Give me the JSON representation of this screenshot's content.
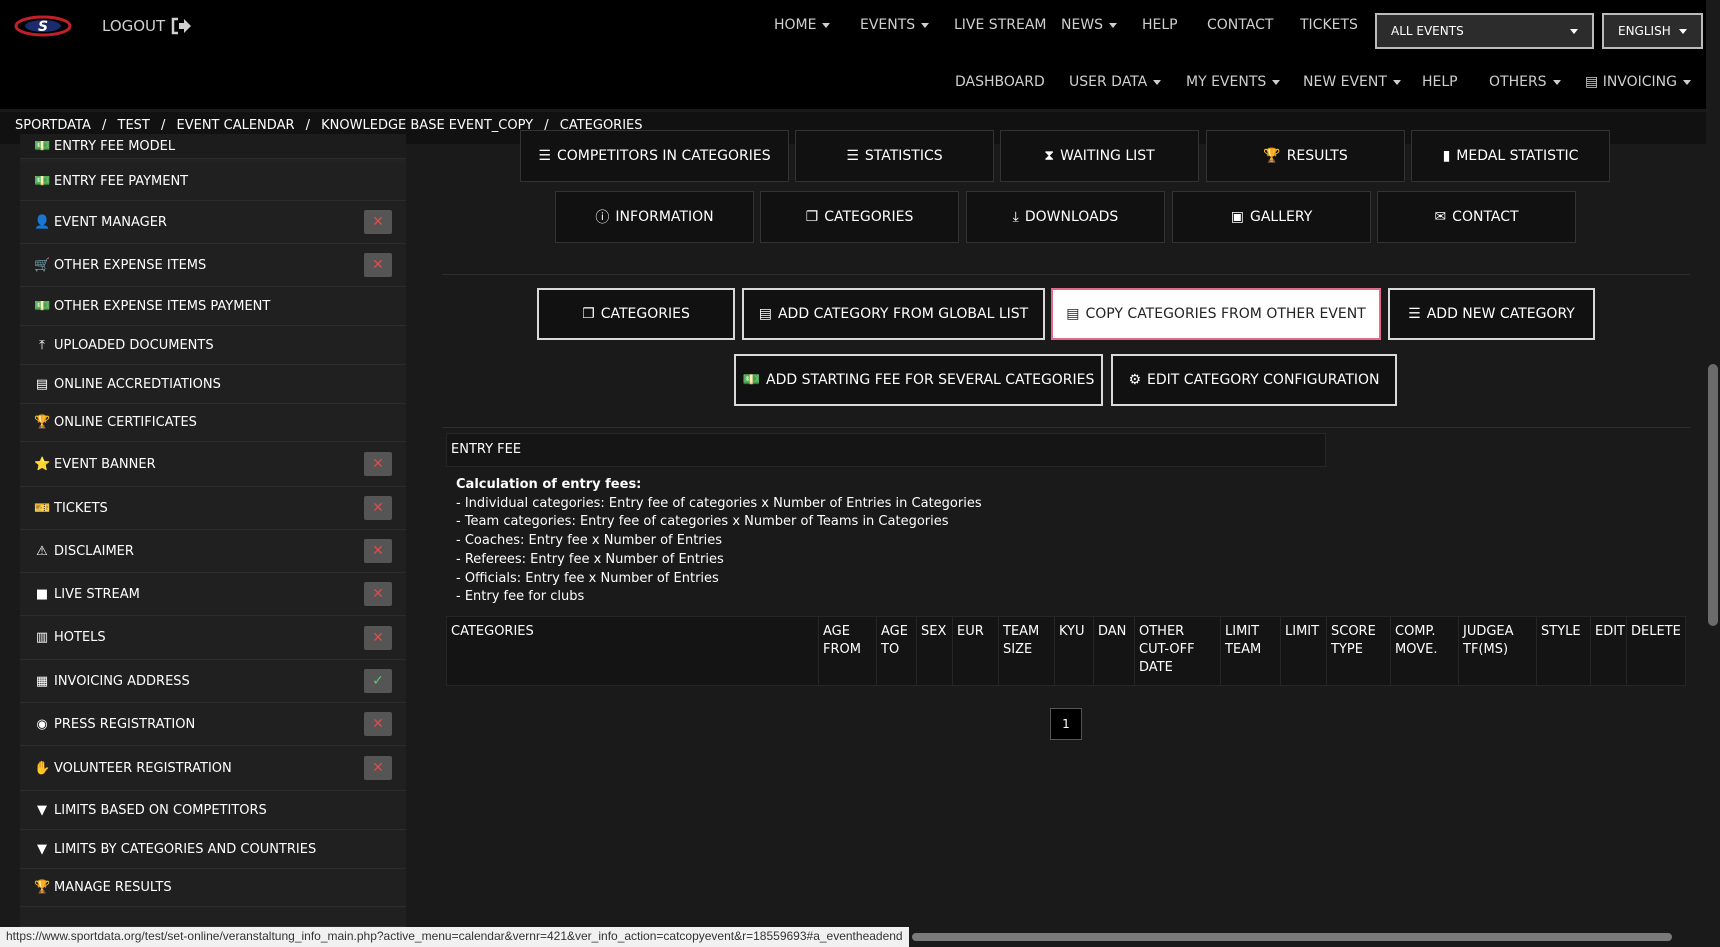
{
  "header": {
    "logout_label": "LOGOUT",
    "nav": [
      {
        "label": "HOME",
        "dropdown": true
      },
      {
        "label": "EVENTS",
        "dropdown": true
      },
      {
        "label": "LIVE STREAM",
        "dropdown": false
      },
      {
        "label": "NEWS",
        "dropdown": true
      },
      {
        "label": "HELP",
        "dropdown": false
      },
      {
        "label": "CONTACT",
        "dropdown": false
      },
      {
        "label": "TICKETS",
        "dropdown": false
      }
    ],
    "events_select": "ALL EVENTS",
    "language_select": "ENGLISH",
    "nav2": [
      {
        "label": "DASHBOARD",
        "dropdown": false
      },
      {
        "label": "USER DATA",
        "dropdown": true
      },
      {
        "label": "MY EVENTS",
        "dropdown": true
      },
      {
        "label": "NEW EVENT",
        "dropdown": true
      },
      {
        "label": "HELP",
        "dropdown": false
      },
      {
        "label": "OTHERS",
        "dropdown": true
      },
      {
        "label": "INVOICING",
        "dropdown": true
      }
    ]
  },
  "breadcrumb": [
    "SPORTDATA",
    "TEST",
    "EVENT CALENDAR",
    "KNOWLEDGE BASE EVENT_COPY",
    "CATEGORIES"
  ],
  "sidebar": {
    "items": [
      {
        "label": "ENTRY FEE MODEL",
        "icon": "money-icon",
        "status": ""
      },
      {
        "label": "ENTRY FEE PAYMENT",
        "icon": "money-icon",
        "status": ""
      },
      {
        "label": "EVENT MANAGER",
        "icon": "user-icon",
        "status": "no"
      },
      {
        "label": "OTHER EXPENSE ITEMS",
        "icon": "cart-icon",
        "status": "no"
      },
      {
        "label": "OTHER EXPENSE ITEMS PAYMENT",
        "icon": "money-icon",
        "status": ""
      },
      {
        "label": "UPLOADED DOCUMENTS",
        "icon": "upload-icon",
        "status": ""
      },
      {
        "label": "ONLINE ACCREDTIATIONS",
        "icon": "id-card-icon",
        "status": ""
      },
      {
        "label": "ONLINE CERTIFICATES",
        "icon": "trophy-icon",
        "status": ""
      },
      {
        "label": "EVENT BANNER",
        "icon": "star-icon",
        "status": "no"
      },
      {
        "label": "TICKETS",
        "icon": "ticket-icon",
        "status": "no"
      },
      {
        "label": "DISCLAIMER",
        "icon": "warning-icon",
        "status": "no"
      },
      {
        "label": "LIVE STREAM",
        "icon": "video-icon",
        "status": "no"
      },
      {
        "label": "HOTELS",
        "icon": "hotel-icon",
        "status": "no"
      },
      {
        "label": "INVOICING ADDRESS",
        "icon": "document-icon",
        "status": "yes"
      },
      {
        "label": "PRESS REGISTRATION",
        "icon": "camera-icon",
        "status": "no"
      },
      {
        "label": "VOLUNTEER REGISTRATION",
        "icon": "hand-icon",
        "status": "no"
      },
      {
        "label": "LIMITS BASED ON COMPETITORS",
        "icon": "filter-icon",
        "status": ""
      },
      {
        "label": "LIMITS BY CATEGORIES AND COUNTRIES",
        "icon": "filter-icon",
        "status": ""
      },
      {
        "label": "MANAGE RESULTS",
        "icon": "trophy-icon",
        "status": ""
      }
    ]
  },
  "tabs_row1": [
    {
      "label": "COMPETITORS IN CATEGORIES",
      "icon": "list-check-icon"
    },
    {
      "label": "STATISTICS",
      "icon": "list-icon"
    },
    {
      "label": "WAITING LIST",
      "icon": "hourglass-icon"
    },
    {
      "label": "RESULTS",
      "icon": "trophy-icon"
    },
    {
      "label": "MEDAL STATISTIC",
      "icon": "bar-chart-icon"
    }
  ],
  "tabs_row2": [
    {
      "label": "INFORMATION",
      "icon": "info-icon"
    },
    {
      "label": "CATEGORIES",
      "icon": "copy-icon"
    },
    {
      "label": "DOWNLOADS",
      "icon": "download-icon"
    },
    {
      "label": "GALLERY",
      "icon": "image-icon"
    },
    {
      "label": "CONTACT",
      "icon": "envelope-icon"
    }
  ],
  "actions_row1": [
    {
      "label": "CATEGORIES",
      "icon": "copy-icon",
      "active": false
    },
    {
      "label": "ADD CATEGORY FROM GLOBAL LIST",
      "icon": "add-folder-icon",
      "active": false
    },
    {
      "label": "COPY CATEGORIES FROM OTHER EVENT",
      "icon": "copy-document-icon",
      "active": true
    },
    {
      "label": "ADD NEW CATEGORY",
      "icon": "list-check-icon",
      "active": false
    }
  ],
  "actions_row2": [
    {
      "label": "ADD STARTING FEE FOR SEVERAL CATEGORIES",
      "icon": "money-icon"
    },
    {
      "label": "EDIT CATEGORY CONFIGURATION",
      "icon": "gear-icon"
    }
  ],
  "entry_fee": {
    "heading": "ENTRY FEE",
    "calc_title": "Calculation of entry fees:",
    "lines": [
      "- Individual categories: Entry fee of categories x Number of Entries in Categories",
      "- Team categories: Entry fee of categories x Number of Teams in Categories",
      "- Coaches: Entry fee x Number of Entries",
      "- Referees: Entry fee x Number of Entries",
      "- Officials: Entry fee x Number of Entries",
      "- Entry fee for clubs"
    ]
  },
  "table": {
    "headers": [
      [
        "CATEGORIES"
      ],
      [
        "AGE",
        "FROM"
      ],
      [
        "AGE",
        "TO"
      ],
      [
        "SEX"
      ],
      [
        "EUR"
      ],
      [
        "TEAM",
        "SIZE"
      ],
      [
        "KYU"
      ],
      [
        "DAN"
      ],
      [
        "OTHER",
        "CUT-OFF",
        "DATE"
      ],
      [
        "LIMIT",
        "TEAM"
      ],
      [
        "LIMIT"
      ],
      [
        "SCORE",
        "TYPE"
      ],
      [
        "COMP.",
        "MOVE."
      ],
      [
        "JUDGEA",
        "TF(MS)"
      ],
      [
        "STYLE"
      ],
      [
        "EDIT"
      ],
      [
        "DELETE"
      ]
    ]
  },
  "pagination": {
    "current": "1"
  },
  "status_url": "https://www.sportdata.org/test/set-online/veranstaltung_info_main.php?active_menu=calendar&vernr=421&ver_info_action=catcopyevent&r=18559693#a_eventheadend"
}
